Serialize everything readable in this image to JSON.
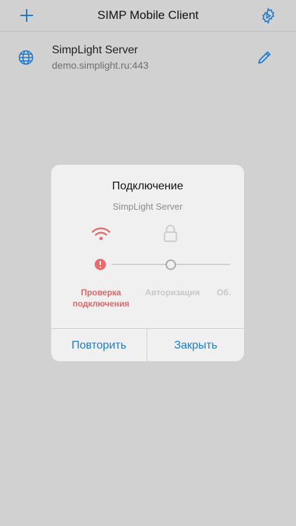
{
  "header": {
    "title": "SIMP Mobile Client",
    "add_icon": "plus-icon",
    "settings_icon": "gear-icon"
  },
  "server": {
    "name": "SimpLight Server",
    "address": "demo.simplight.ru:443",
    "icon": "globe-icon",
    "edit_icon": "pencil-icon"
  },
  "dialog": {
    "title": "Подключение",
    "subtitle": "SimpLight Server",
    "steps": [
      {
        "label": "Проверка подключения",
        "state": "error"
      },
      {
        "label": "Авторизация",
        "state": "pending"
      },
      {
        "label": "Об…",
        "state": "pending"
      }
    ],
    "buttons": {
      "retry": "Повторить",
      "close": "Закрыть"
    }
  },
  "colors": {
    "accent": "#1e7bd0",
    "error": "#ec6a6a",
    "background": "#d1d1d1",
    "dialog": "#f0f0f0"
  }
}
